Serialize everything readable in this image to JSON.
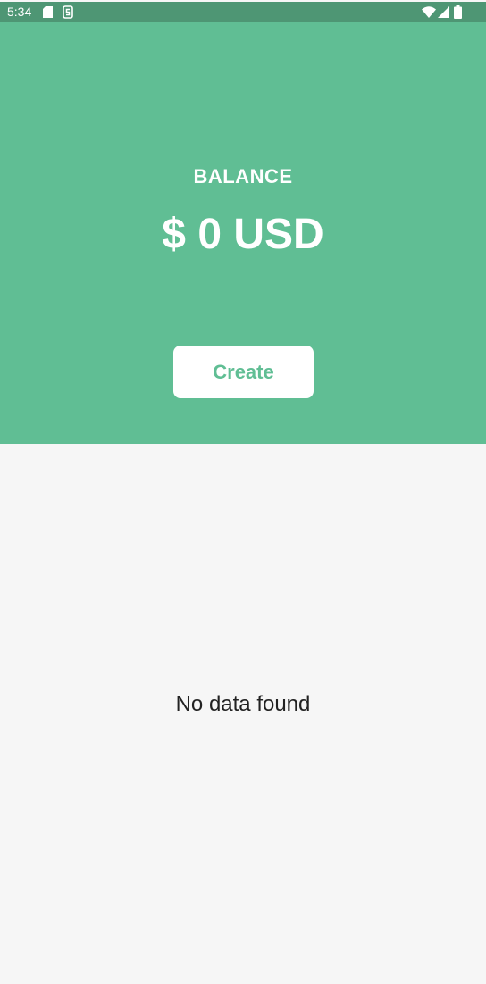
{
  "status_bar": {
    "time": "5:34",
    "icons": [
      "sd-card-icon",
      "s-notification-icon",
      "wifi-icon",
      "signal-icon",
      "battery-icon"
    ]
  },
  "header": {
    "balance_label": "BALANCE",
    "balance_amount": "$ 0 USD",
    "create_label": "Create"
  },
  "main": {
    "empty_message": "No data found"
  },
  "colors": {
    "accent": "#60be94",
    "status_bar": "#4e9674",
    "background": "#f6f6f6",
    "text": "#222222"
  }
}
